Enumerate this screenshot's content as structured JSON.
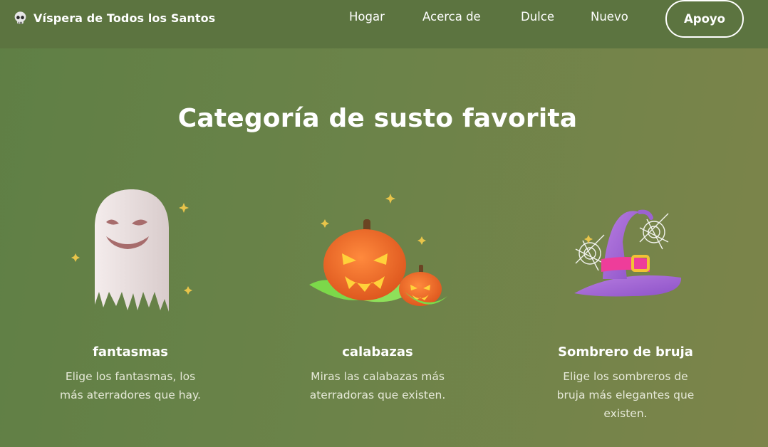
{
  "header": {
    "brand": "Víspera de Todos los Santos",
    "brand_icon": "skull-icon",
    "nav": [
      "Hogar",
      "Acerca de",
      "Dulce",
      "Nuevo"
    ],
    "cta": "Apoyo"
  },
  "section": {
    "title": "Categoría de susto favorita"
  },
  "categories": [
    {
      "title": "fantasmas",
      "description": "Elige los fantasmas, los más aterradores que hay.",
      "icon": "ghost-icon"
    },
    {
      "title": "calabazas",
      "description": "Miras las calabazas más aterradoras que existen.",
      "icon": "pumpkin-icon"
    },
    {
      "title": "Sombrero de bruja",
      "description": "Elige los sombreros de bruja más elegantes que existen.",
      "icon": "witch-hat-icon"
    }
  ],
  "colors": {
    "background": "#657f46",
    "header": "#5c7440",
    "text": "#ffffff"
  }
}
